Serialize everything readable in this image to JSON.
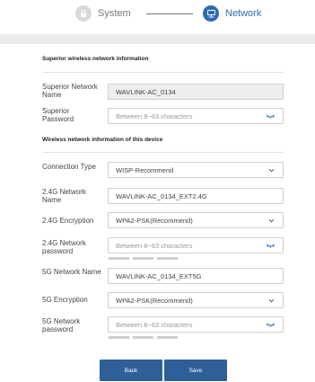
{
  "stepper": {
    "step1_label": "System",
    "step2_label": "Network"
  },
  "superior": {
    "title": "Superior wireless network information",
    "network_name_label": "Superior Network Name",
    "network_name_value": "WAVLINK-AC_0134",
    "password_label": "Superior Password",
    "password_placeholder": "Between 8~63 characters"
  },
  "device": {
    "title": "Wireless network information of this device",
    "connection_type_label": "Connection Type",
    "connection_type_value": "WISP-Recommend",
    "g24_name_label": "2.4G Network Name",
    "g24_name_value": "WAVLINK-AC_0134_EXT2.4G",
    "g24_encryption_label": "2.4G Encryption",
    "g24_encryption_value": "WPA2-PSK(Recommend)",
    "g24_password_label": "2.4G Network password",
    "g24_password_placeholder": "Between 8~63 characters",
    "g5_name_label": "5G Network Name",
    "g5_name_value": "WAVLINK-AC_0134_EXT5G",
    "g5_encryption_label": "5G Encryption",
    "g5_encryption_value": "WPA2-PSK(Recommend)",
    "g5_password_label": "5G Network password",
    "g5_password_placeholder": "Between 8~63 characters"
  },
  "buttons": {
    "back_label": "Back",
    "save_label": "Save"
  },
  "icons": {
    "system": "lock-icon",
    "network": "network-icon",
    "eye": "eye-closed-icon",
    "chevron": "chevron-down-icon"
  },
  "colors": {
    "accent": "#2f6bb3",
    "button": "#2f5f97",
    "band": "#ebebeb"
  }
}
